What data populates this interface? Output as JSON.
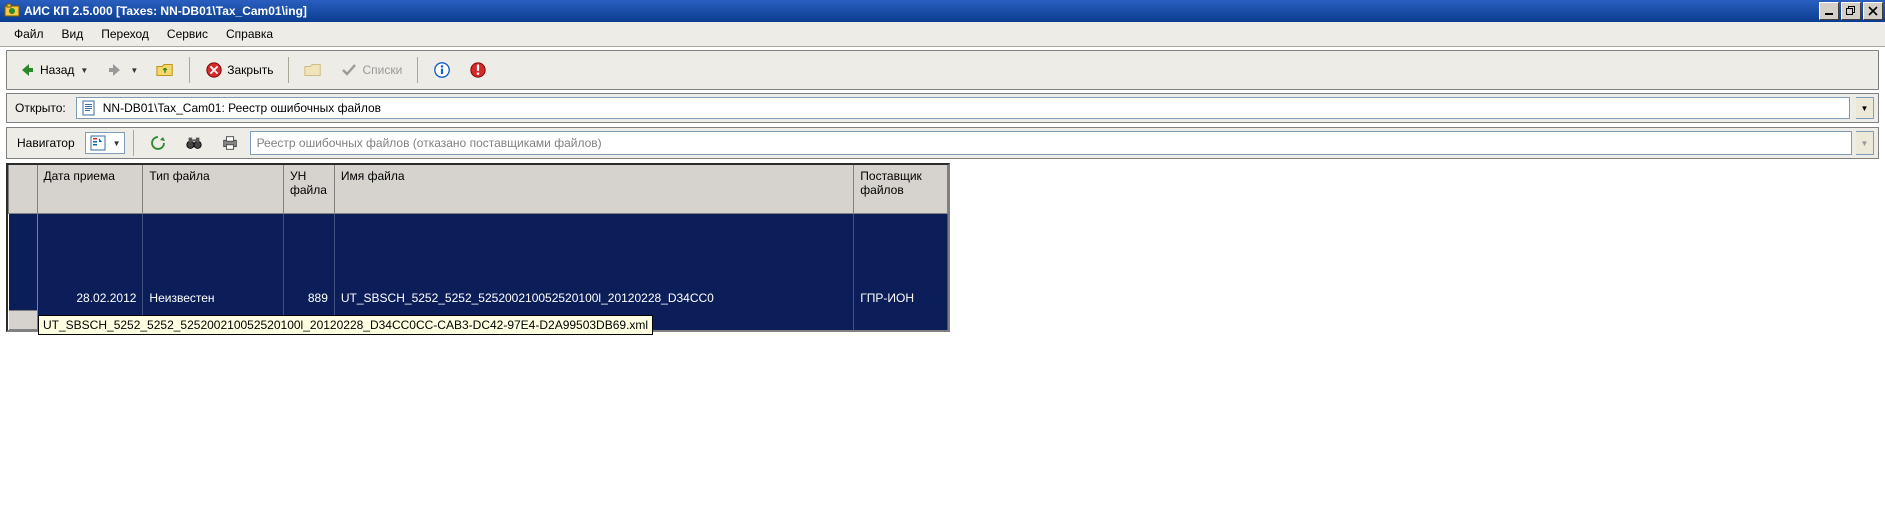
{
  "titlebar": {
    "title": "АИС КП 2.5.000 [Taxes: NN-DB01\\Tax_Cam01\\ing]"
  },
  "menu": {
    "file": "Файл",
    "view": "Вид",
    "goto": "Переход",
    "service": "Сервис",
    "help": "Справка"
  },
  "toolbar": {
    "back": "Назад",
    "close": "Закрыть",
    "lists": "Списки"
  },
  "addressbar": {
    "label": "Открыто:",
    "value": "NN-DB01\\Tax_Cam01: Реестр ошибочных файлов"
  },
  "filterbar": {
    "label": "Навигатор",
    "placeholder": "Реестр ошибочных файлов (отказано поставщиками файлов)"
  },
  "grid": {
    "headers": {
      "date": "Дата приема",
      "type": "Тип файла",
      "un": "УН файла",
      "name": "Имя файла",
      "supplier": "Поставщик файлов"
    },
    "row": {
      "date": "28.02.2012",
      "type": "Неизвестен",
      "un": "889",
      "name": "UT_SBSCH_5252_5252_525200210052520100l_20120228_D34CC0",
      "supplier": "ГПР-ИОН"
    },
    "tooltip": "UT_SBSCH_5252_5252_525200210052520100l_20120228_D34CC0CC-CAB3-DC42-97E4-D2A99503DB69.xml"
  }
}
